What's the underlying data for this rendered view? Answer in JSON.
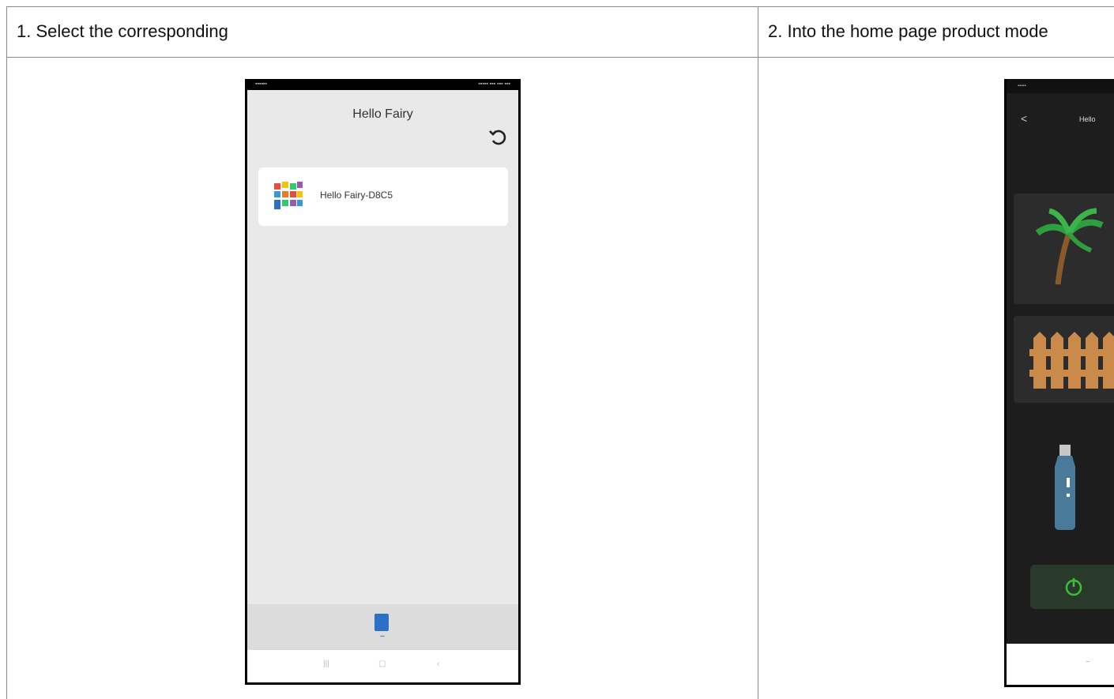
{
  "table": {
    "col1_header": "1. Select the corresponding",
    "col2_header": "2. Into the home page product mode"
  },
  "phone1": {
    "title": "Hello Fairy",
    "device_name": "Hello Fairy-D8C5",
    "refresh_icon": "refresh-icon",
    "tab_icon": "device-tab-icon"
  },
  "phone2": {
    "back_glyph": "<",
    "title": "Hello",
    "tiles": [
      "palm-tree-icon",
      "fence-icon",
      "bottle-light-icon"
    ],
    "power_icon": "power-icon"
  },
  "colors": {
    "accent_blue": "#2b6fc6",
    "dark_bg": "#1d1d1d",
    "power_green": "#3dbb3d"
  }
}
